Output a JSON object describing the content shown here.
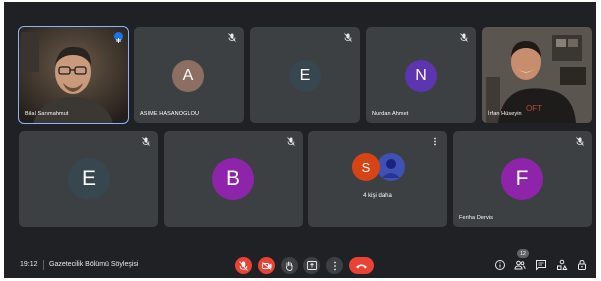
{
  "participants": [
    {
      "name": "Bilal Sarımahmut",
      "type": "video",
      "speaking": true
    },
    {
      "name": "ASIME HASANOGLOU",
      "initial": "A",
      "color": "#8d6e63"
    },
    {
      "name": "",
      "initial": "E",
      "color": "#37474f"
    },
    {
      "name": "Nurdan Ahmet",
      "initial": "N",
      "color": "#5e35b1"
    },
    {
      "name": "İrfan Hüseyin",
      "type": "video"
    },
    {
      "name": "",
      "initial": "E",
      "color": "#37474f"
    },
    {
      "name": "",
      "initial": "B",
      "color": "#8e24aa"
    },
    {
      "name": "",
      "initial": "F",
      "color": "#8e24aa"
    }
  ],
  "overflow": {
    "label": "4 kişi daha",
    "initial": "S",
    "initial_color": "#d84315"
  },
  "farewell_tile": {
    "name": "Feriha Dervis"
  },
  "meeting": {
    "time": "19:12",
    "title": "Gazetecilik Bölümü Söyleşisi"
  },
  "people_count": "12",
  "controls": [
    "mic-off",
    "camera-off",
    "raise-hand",
    "present",
    "more",
    "hang-up"
  ],
  "right_icons": [
    "info",
    "people",
    "chat",
    "activities",
    "host-controls"
  ]
}
